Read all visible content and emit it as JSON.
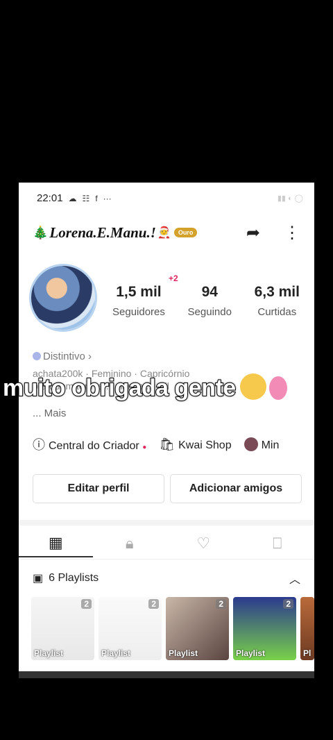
{
  "status": {
    "time": "22:01",
    "more": "···"
  },
  "profile": {
    "name": "Lorena.E.Manu.!",
    "tier_badge": "Ouro",
    "new_followers": "+2",
    "stats": [
      {
        "value": "1,5 mil",
        "label": "Seguidores"
      },
      {
        "value": "94",
        "label": "Seguindo"
      },
      {
        "value": "6,3 mil",
        "label": "Curtidas"
      }
    ],
    "distintivo": "Distintivo",
    "bio_line1": "achata200k · Feminino · Capricórnio",
    "bio_line2": "pra quem tem te ... nunca ... mil",
    "mais": "... Mais"
  },
  "quick_links": {
    "creator": "Central do Criador",
    "shop": "Kwai Shop",
    "mini": "Min"
  },
  "buttons": {
    "edit": "Editar perfil",
    "add": "Adicionar amigos"
  },
  "playlists": {
    "title": "6 Playlists",
    "items": [
      {
        "count": "2",
        "label": "Playlist"
      },
      {
        "count": "2",
        "label": "Playlist"
      },
      {
        "count": "2",
        "label": "Playlist"
      },
      {
        "count": "2",
        "label": "Playlist"
      },
      {
        "label": "Pl"
      }
    ]
  },
  "overlay": {
    "caption": "muito obrigada gente"
  },
  "colors": {
    "accent_red": "#e0245e",
    "gold": "#d4a12a"
  }
}
